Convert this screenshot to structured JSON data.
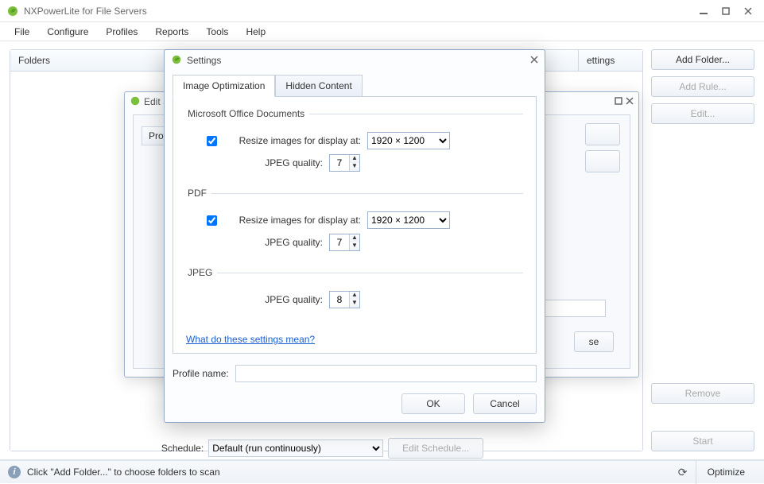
{
  "app": {
    "title": "NXPowerLite for File Servers"
  },
  "menu": {
    "file": "File",
    "configure": "Configure",
    "profiles": "Profiles",
    "reports": "Reports",
    "tools": "Tools",
    "help": "Help"
  },
  "main": {
    "folders_col": "Folders",
    "settings_col": "ettings",
    "schedule_label": "Schedule:",
    "schedule_value": "Default (run continuously)",
    "edit_schedule": "Edit Schedule..."
  },
  "sidebar": {
    "add_folder": "Add Folder...",
    "add_rule": "Add Rule...",
    "edit": "Edit...",
    "remove": "Remove",
    "start": "Start"
  },
  "status": {
    "hint": "Click \"Add Folder...\" to choose folders to scan",
    "optimize": "Optimize"
  },
  "edit_window": {
    "title": "Edit S",
    "profile_col": "Profile",
    "se_btn": "se"
  },
  "settings": {
    "title": "Settings",
    "tabs": {
      "image_opt": "Image Optimization",
      "hidden": "Hidden Content"
    },
    "office": {
      "legend": "Microsoft Office Documents",
      "resize_label": "Resize images for display at:",
      "resize_value": "1920 × 1200",
      "jpeg_label": "JPEG quality:",
      "jpeg_value": "7"
    },
    "pdf": {
      "legend": "PDF",
      "resize_label": "Resize images for display at:",
      "resize_value": "1920 × 1200",
      "jpeg_label": "JPEG quality:",
      "jpeg_value": "7"
    },
    "jpeg": {
      "legend": "JPEG",
      "jpeg_label": "JPEG quality:",
      "jpeg_value": "8"
    },
    "help_link": "What do these settings mean?",
    "profile_name_label": "Profile name:",
    "profile_name_value": "",
    "ok": "OK",
    "cancel": "Cancel"
  }
}
